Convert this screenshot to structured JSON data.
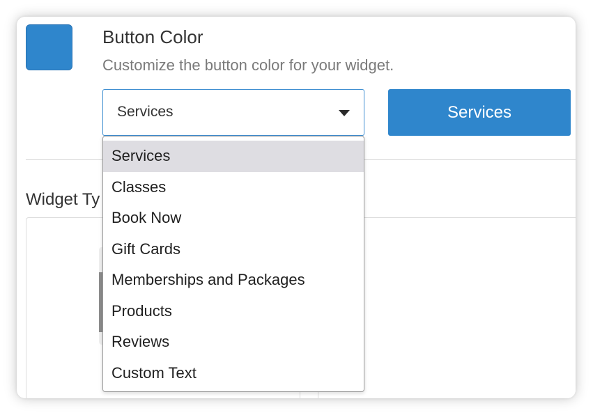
{
  "colors": {
    "brand": "#2f86cc",
    "swatch": "#2f86cc",
    "selected_option_bg": "#dedde2"
  },
  "button_color": {
    "title": "Button Color",
    "subtitle": "Customize the button color for your widget.",
    "select_value": "Services",
    "preview_button_label": "Services"
  },
  "widget_type": {
    "heading": "Widget Ty"
  },
  "dropdown": {
    "options": [
      {
        "label": "Services",
        "selected": true
      },
      {
        "label": "Classes",
        "selected": false
      },
      {
        "label": "Book Now",
        "selected": false
      },
      {
        "label": "Gift Cards",
        "selected": false
      },
      {
        "label": "Memberships and Packages",
        "selected": false
      },
      {
        "label": "Products",
        "selected": false
      },
      {
        "label": "Reviews",
        "selected": false
      },
      {
        "label": "Custom Text",
        "selected": false
      }
    ]
  }
}
